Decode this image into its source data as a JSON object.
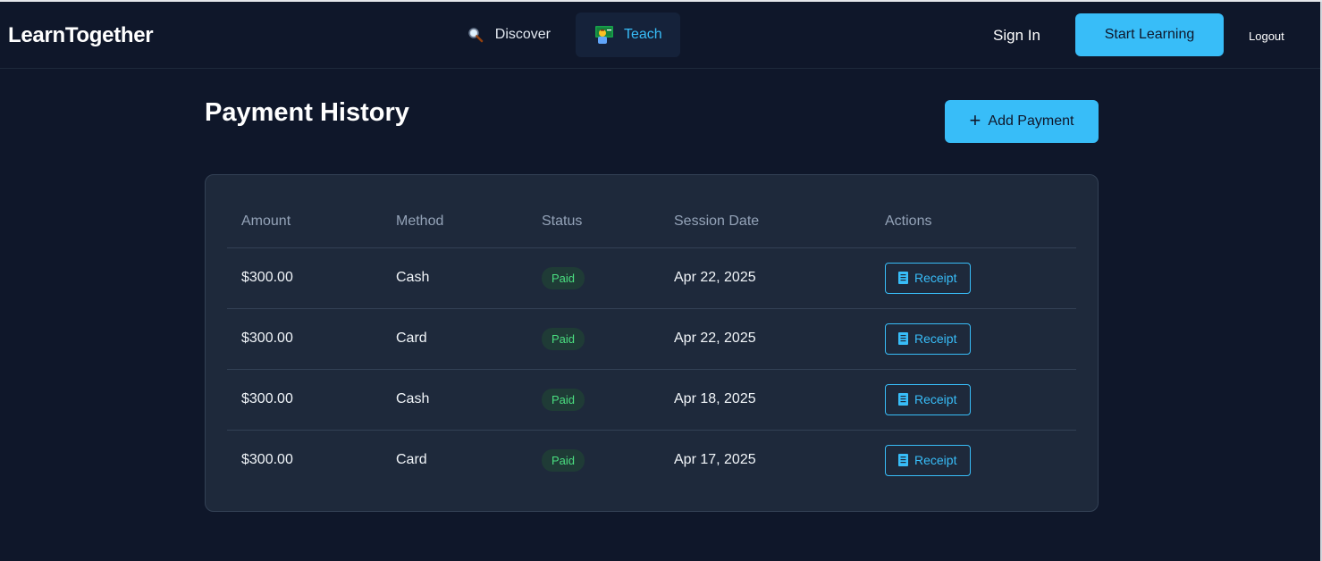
{
  "navbar": {
    "brand": "LearnTogether",
    "links": [
      {
        "label": "Discover",
        "icon": "magnifier-icon"
      },
      {
        "label": "Teach",
        "icon": "teacher-icon"
      }
    ],
    "sign_in": "Sign In",
    "start_learning": "Start Learning",
    "logout": "Logout"
  },
  "page": {
    "title": "Payment History",
    "add_button": "Add Payment"
  },
  "table": {
    "headers": [
      "Amount",
      "Method",
      "Status",
      "Session Date",
      "Actions"
    ],
    "rows": [
      {
        "amount": "$300.00",
        "method": "Cash",
        "status": "Paid",
        "date": "Apr 22, 2025",
        "action": "Receipt"
      },
      {
        "amount": "$300.00",
        "method": "Card",
        "status": "Paid",
        "date": "Apr 22, 2025",
        "action": "Receipt"
      },
      {
        "amount": "$300.00",
        "method": "Cash",
        "status": "Paid",
        "date": "Apr 18, 2025",
        "action": "Receipt"
      },
      {
        "amount": "$300.00",
        "method": "Card",
        "status": "Paid",
        "date": "Apr 17, 2025",
        "action": "Receipt"
      }
    ]
  },
  "colors": {
    "background": "#0f172a",
    "card": "#1e293b",
    "accent": "#38bdf8",
    "success": "#4ade80"
  }
}
